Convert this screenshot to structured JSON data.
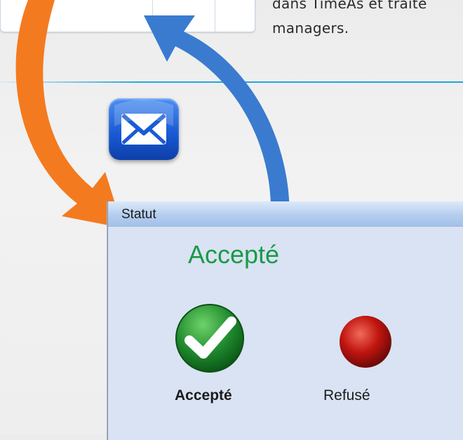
{
  "background_text": {
    "lines": [
      "dans TimeAs et traite",
      "managers."
    ]
  },
  "status_dialog": {
    "title": "Statut",
    "current_status": "Accepté",
    "options": [
      {
        "label": "Accepté",
        "icon": "check-icon",
        "color": "#1f8a2e",
        "selected": true
      },
      {
        "label": "Refusé",
        "icon": "red-circle-icon",
        "color": "#c0150f",
        "selected": false
      }
    ]
  },
  "icons": {
    "mail": "mail-icon"
  },
  "colors": {
    "status_green": "#1a9a47",
    "arrow_orange": "#f47a1f",
    "arrow_blue": "#3a7bd0",
    "divider_blue": "#1fa4df"
  }
}
